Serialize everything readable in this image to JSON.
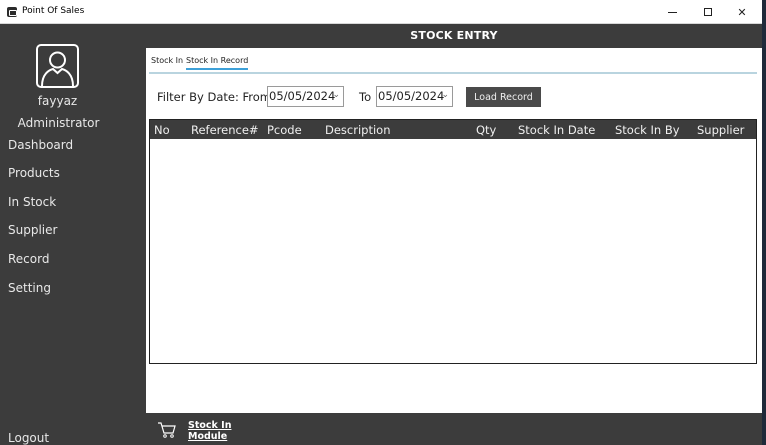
{
  "window": {
    "title": "Point Of Sales"
  },
  "sidebar": {
    "user_name": "fayyaz",
    "user_role": "Administrator",
    "items": [
      {
        "label": "Dashboard"
      },
      {
        "label": "Products"
      },
      {
        "label": "In Stock"
      },
      {
        "label": "Supplier"
      },
      {
        "label": "Record"
      },
      {
        "label": "Setting"
      }
    ],
    "logout_label": "Logout"
  },
  "header": {
    "title": "STOCK ENTRY"
  },
  "tabs": [
    {
      "label": "Stock In",
      "active": false
    },
    {
      "label": "Stock In Record",
      "active": true
    }
  ],
  "filter": {
    "label": "Filter By Date: From",
    "from_value": "05/05/2024",
    "to_label": "To",
    "to_value": "05/05/2024",
    "load_button": "Load Record"
  },
  "table": {
    "columns": [
      "No",
      "Reference#",
      "Pcode",
      "Description",
      "Qty",
      "Stock In Date",
      "Stock In By",
      "Supplier"
    ],
    "rows": []
  },
  "footer": {
    "module_label": "Stock In Module",
    "icon": "cart-icon"
  },
  "colors": {
    "sidebar_bg": "#3c3c3c",
    "panel_bg": "#ffffff",
    "tab_accent": "#3da0d8"
  }
}
